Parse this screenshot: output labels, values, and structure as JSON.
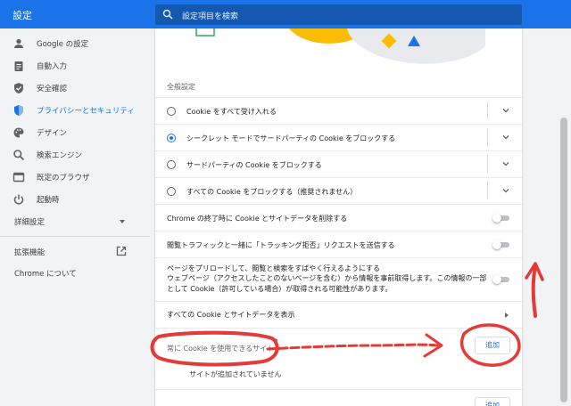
{
  "header": {
    "title": "設定",
    "search_placeholder": "設定項目を検索"
  },
  "sidebar": {
    "items": [
      {
        "label": "Google の設定",
        "icon": "person-icon"
      },
      {
        "label": "自動入力",
        "icon": "clipboard-icon"
      },
      {
        "label": "安全確認",
        "icon": "shield-check-icon"
      },
      {
        "label": "プライバシーとセキュリティ",
        "icon": "shield-icon",
        "active": true
      },
      {
        "label": "デザイン",
        "icon": "palette-icon"
      },
      {
        "label": "検索エンジン",
        "icon": "search-icon"
      },
      {
        "label": "既定のブラウザ",
        "icon": "browser-icon"
      },
      {
        "label": "起動時",
        "icon": "power-icon"
      }
    ],
    "advanced": "詳細設定",
    "extensions": "拡張機能",
    "about": "Chrome について"
  },
  "main": {
    "section_title": "全般設定",
    "cookie_options": [
      {
        "label": "Cookie をすべて受け入れる",
        "selected": false
      },
      {
        "label": "シークレット モードでサードパーティの Cookie をブロックする",
        "selected": true
      },
      {
        "label": "サードパーティの Cookie をブロックする",
        "selected": false
      },
      {
        "label": "すべての Cookie をブロックする（推奨されません）",
        "selected": false
      }
    ],
    "clear_on_exit": "Chrome の終了時に Cookie とサイトデータを削除する",
    "do_not_track": "閲覧トラフィックと一緒に「トラッキング拒否」リクエストを送信する",
    "preload_title": "ページをプリロードして、閲覧と検索をすばやく行えるようにする",
    "preload_desc_1": "ウェブページ（アクセスしたことのないページを含む）から情報を事前取得します。この情報の一部",
    "preload_desc_2": "として Cookie（許可している場合）が取得される可能性があります。",
    "see_all_cookies": "すべての Cookie とサイトデータを表示",
    "always_allow": "常に Cookie を使用できるサイト",
    "add_button": "追加",
    "no_sites": "サイトが追加されていません",
    "add_button_2": "追加"
  },
  "colors": {
    "accent": "#1a73e8",
    "header": "#1a73e8",
    "annotation": "#e0211f"
  }
}
